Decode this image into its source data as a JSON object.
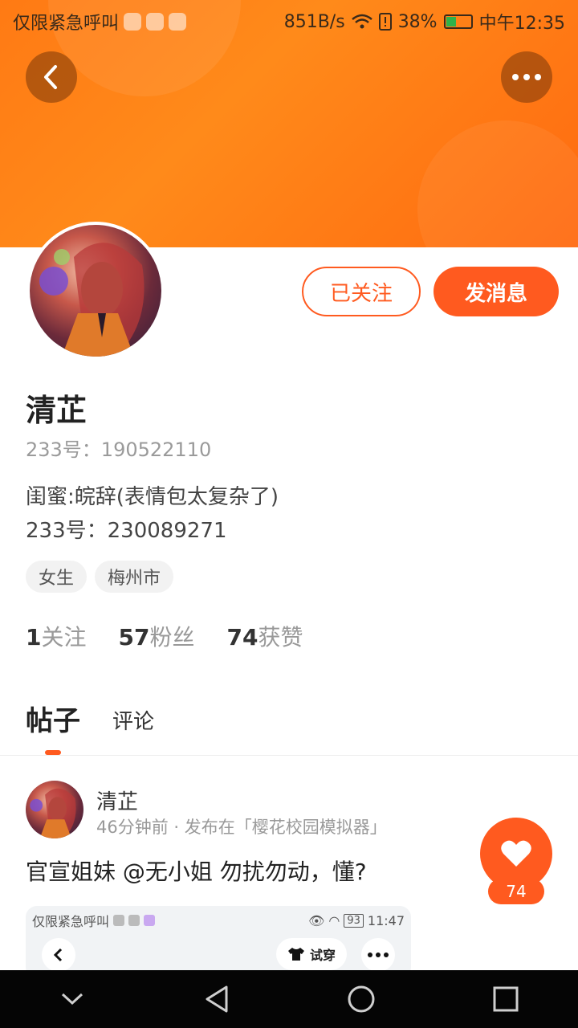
{
  "statusbar": {
    "left_text": "仅限紧急呼叫",
    "speed": "851B/s",
    "battery": "38%",
    "time": "中午12:35"
  },
  "header": {
    "back_icon": "chevron-left-icon",
    "more_icon": "ellipsis-icon",
    "color": "#ff7a14"
  },
  "profile": {
    "follow_label": "已关注",
    "message_label": "发消息",
    "name": "清芷",
    "uid": "233号：190522110",
    "bio_line1": "闺蜜:皖辞(表情包太复杂了)",
    "bio_line2": "233号：230089271",
    "tags": [
      "女生",
      "梅州市"
    ],
    "stats": {
      "following_count": "1",
      "following_label": "关注",
      "fans_count": "57",
      "fans_label": "粉丝",
      "likes_count": "74",
      "likes_label": "获赞"
    }
  },
  "tabs": {
    "active": "帖子",
    "other": "评论"
  },
  "post": {
    "author": "清芷",
    "meta": "46分钟前 · 发布在「樱花校园模拟器」",
    "text": "官宣姐妹  @无小姐 勿扰勿动，懂?",
    "like_count": "74",
    "screenshot": {
      "status_left": "仅限紧急呼叫",
      "battery": "93",
      "time": "11:47",
      "try_label": "试穿"
    }
  },
  "accent_color": "#ff5a1f"
}
